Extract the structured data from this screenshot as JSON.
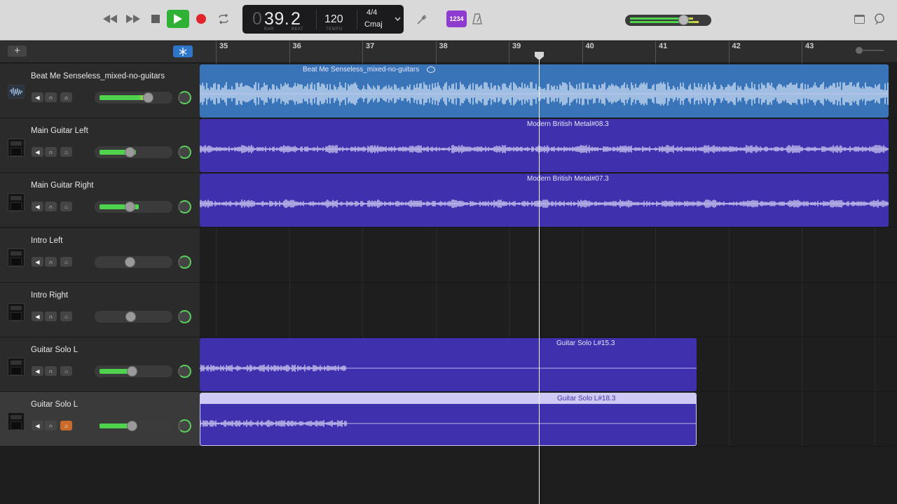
{
  "transport": {
    "rewind_icon": "rewind-icon",
    "forward_icon": "fast-forward-icon",
    "stop_icon": "stop-icon",
    "play_icon": "play-icon",
    "record_icon": "record-icon",
    "cycle_icon": "cycle-icon"
  },
  "lcd": {
    "bar_value": "39.",
    "beat_value": "2",
    "bar_label": "BAR",
    "beat_label": "BEAT",
    "tempo_value": "120",
    "tempo_label": "TEMPO",
    "time_signature": "4/4",
    "key": "Cmaj"
  },
  "tools": {
    "count_in_label": "1234",
    "tuner_icon": "tuning-fork-icon",
    "metronome_icon": "metronome-icon"
  },
  "ruler": {
    "bars": [
      "35",
      "36",
      "37",
      "38",
      "39",
      "40",
      "41",
      "42",
      "43"
    ]
  },
  "tracks": [
    {
      "name": "Beat Me Senseless_mixed-no-guitars",
      "icon": "audio-waveform-icon",
      "volume": 0.72,
      "level": 0.8,
      "region": {
        "name": "Beat Me Senseless_mixed-no-guitars"
      }
    },
    {
      "name": "Main Guitar Left",
      "icon": "amp-icon",
      "volume": 0.45,
      "level": 0.6,
      "region": {
        "name": "Modern British Metal#08.3"
      }
    },
    {
      "name": "Main Guitar Right",
      "icon": "amp-icon",
      "volume": 0.45,
      "level": 0.65,
      "region": {
        "name": "Modern British Metal#07.3"
      }
    },
    {
      "name": "Intro Left",
      "icon": "amp-icon",
      "volume": 0.45,
      "level": 0,
      "region": null
    },
    {
      "name": "Intro Right",
      "icon": "amp-icon",
      "volume": 0.46,
      "level": 0,
      "region": null
    },
    {
      "name": "Guitar Solo L",
      "icon": "amp-icon",
      "volume": 0.48,
      "level": 0.55,
      "region": {
        "name": "Guitar Solo L#15.3"
      }
    },
    {
      "name": "Guitar Solo L",
      "icon": "amp-icon",
      "volume": 0.48,
      "level": 0.5,
      "record_enabled": true,
      "region": {
        "name": "Guitar Solo L#18.3"
      }
    }
  ],
  "colors": {
    "audio_region": "#3a74b8",
    "guitar_region": "#3f31ad",
    "selected_region_top": "#cfcaf5",
    "play_green": "#2eb135",
    "record_red": "#e0262b",
    "count_in_purple": "#8e3bd0",
    "level_green": "#4fd34f"
  }
}
